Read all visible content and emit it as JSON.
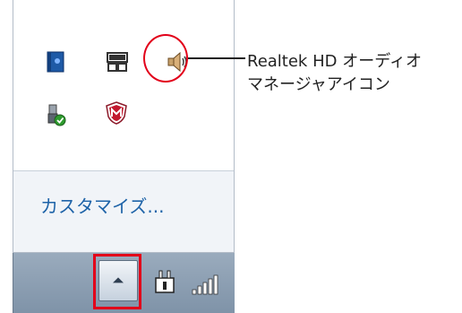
{
  "popup": {
    "customize_label": "カスタマイズ...",
    "icons": [
      {
        "name": "book-icon"
      },
      {
        "name": "network-icon"
      },
      {
        "name": "speaker-icon"
      },
      {
        "name": "usb-device-icon"
      },
      {
        "name": "mcafee-shield-icon"
      }
    ]
  },
  "taskbar": {
    "show_hidden_icon": "chevron-up-icon",
    "power_icon": "power-plug-icon",
    "signal_icon": "signal-bars-icon"
  },
  "callout": {
    "line1": "Realtek HD オーディオ",
    "line2": "マネージャアイコン"
  },
  "colors": {
    "highlight": "#e2001a",
    "link": "#1e63a8"
  }
}
